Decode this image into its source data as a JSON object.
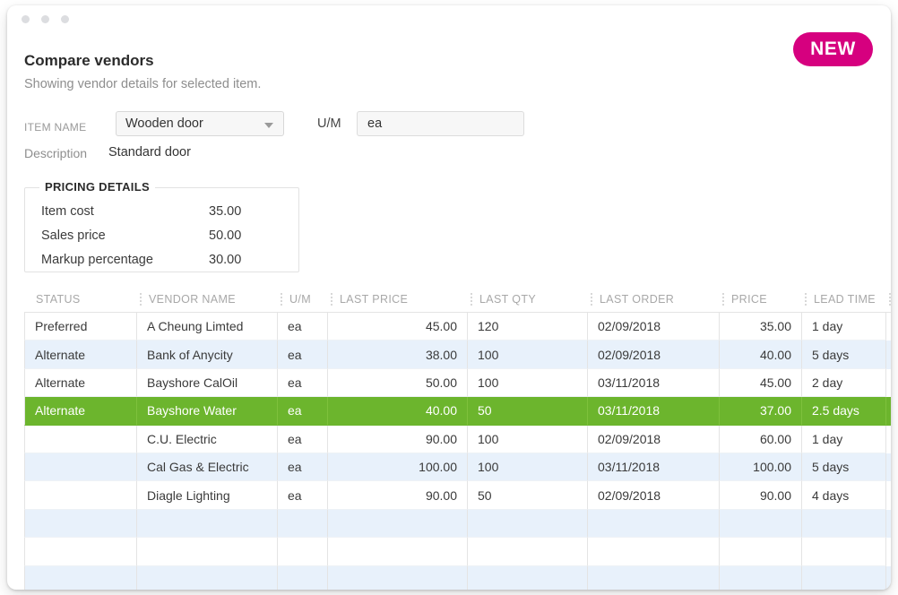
{
  "window": {
    "traffic_lights": [
      "close-dot",
      "minimize-dot",
      "maximize-dot"
    ]
  },
  "badge": {
    "label": "NEW",
    "color": "#d6007f"
  },
  "header": {
    "title": "Compare vendors",
    "subtitle": "Showing vendor details for selected item."
  },
  "form": {
    "item_name_label": "ITEM NAME",
    "item_name_value": "Wooden door",
    "um_label": "U/M",
    "um_value": "ea",
    "description_label": "Description",
    "description_value": "Standard door"
  },
  "pricing": {
    "legend": "PRICING DETAILS",
    "rows": [
      {
        "key": "Item cost",
        "value": "35.00"
      },
      {
        "key": "Sales price",
        "value": "50.00"
      },
      {
        "key": "Markup percentage",
        "value": "30.00"
      }
    ]
  },
  "table": {
    "columns": [
      {
        "label": "STATUS",
        "align": "left"
      },
      {
        "label": "VENDOR NAME",
        "align": "left"
      },
      {
        "label": "U/M",
        "align": "left"
      },
      {
        "label": "LAST PRICE",
        "align": "right"
      },
      {
        "label": "LAST QTY",
        "align": "left"
      },
      {
        "label": "LAST ORDER",
        "align": "left"
      },
      {
        "label": "PRICE",
        "align": "right"
      },
      {
        "label": "LEAD TIME",
        "align": "left"
      }
    ],
    "selected_row_index": 3,
    "selected_color": "#6cb52d",
    "stripe_color": "#e8f1fb",
    "rows": [
      {
        "status": "Preferred",
        "vendor_name": "A Cheung Limted",
        "um": "ea",
        "last_price": "45.00",
        "last_qty": "120",
        "last_order": "02/09/2018",
        "price": "35.00",
        "lead_time": "1 day"
      },
      {
        "status": "Alternate",
        "vendor_name": "Bank of Anycity",
        "um": "ea",
        "last_price": "38.00",
        "last_qty": "100",
        "last_order": "02/09/2018",
        "price": "40.00",
        "lead_time": "5 days"
      },
      {
        "status": "Alternate",
        "vendor_name": "Bayshore CalOil",
        "um": "ea",
        "last_price": "50.00",
        "last_qty": "100",
        "last_order": "03/11/2018",
        "price": "45.00",
        "lead_time": "2 day"
      },
      {
        "status": "Alternate",
        "vendor_name": "Bayshore Water",
        "um": "ea",
        "last_price": "40.00",
        "last_qty": "50",
        "last_order": "03/11/2018",
        "price": "37.00",
        "lead_time": "2.5 days"
      },
      {
        "status": "",
        "vendor_name": "C.U. Electric",
        "um": "ea",
        "last_price": "90.00",
        "last_qty": "100",
        "last_order": "02/09/2018",
        "price": "60.00",
        "lead_time": "1 day"
      },
      {
        "status": "",
        "vendor_name": "Cal Gas & Electric",
        "um": "ea",
        "last_price": "100.00",
        "last_qty": "100",
        "last_order": "03/11/2018",
        "price": "100.00",
        "lead_time": "5 days"
      },
      {
        "status": "",
        "vendor_name": "Diagle Lighting",
        "um": "ea",
        "last_price": "90.00",
        "last_qty": "50",
        "last_order": "02/09/2018",
        "price": "90.00",
        "lead_time": "4 days"
      },
      {
        "status": "",
        "vendor_name": "",
        "um": "",
        "last_price": "",
        "last_qty": "",
        "last_order": "",
        "price": "",
        "lead_time": ""
      },
      {
        "status": "",
        "vendor_name": "",
        "um": "",
        "last_price": "",
        "last_qty": "",
        "last_order": "",
        "price": "",
        "lead_time": ""
      },
      {
        "status": "",
        "vendor_name": "",
        "um": "",
        "last_price": "",
        "last_qty": "",
        "last_order": "",
        "price": "",
        "lead_time": ""
      }
    ]
  }
}
